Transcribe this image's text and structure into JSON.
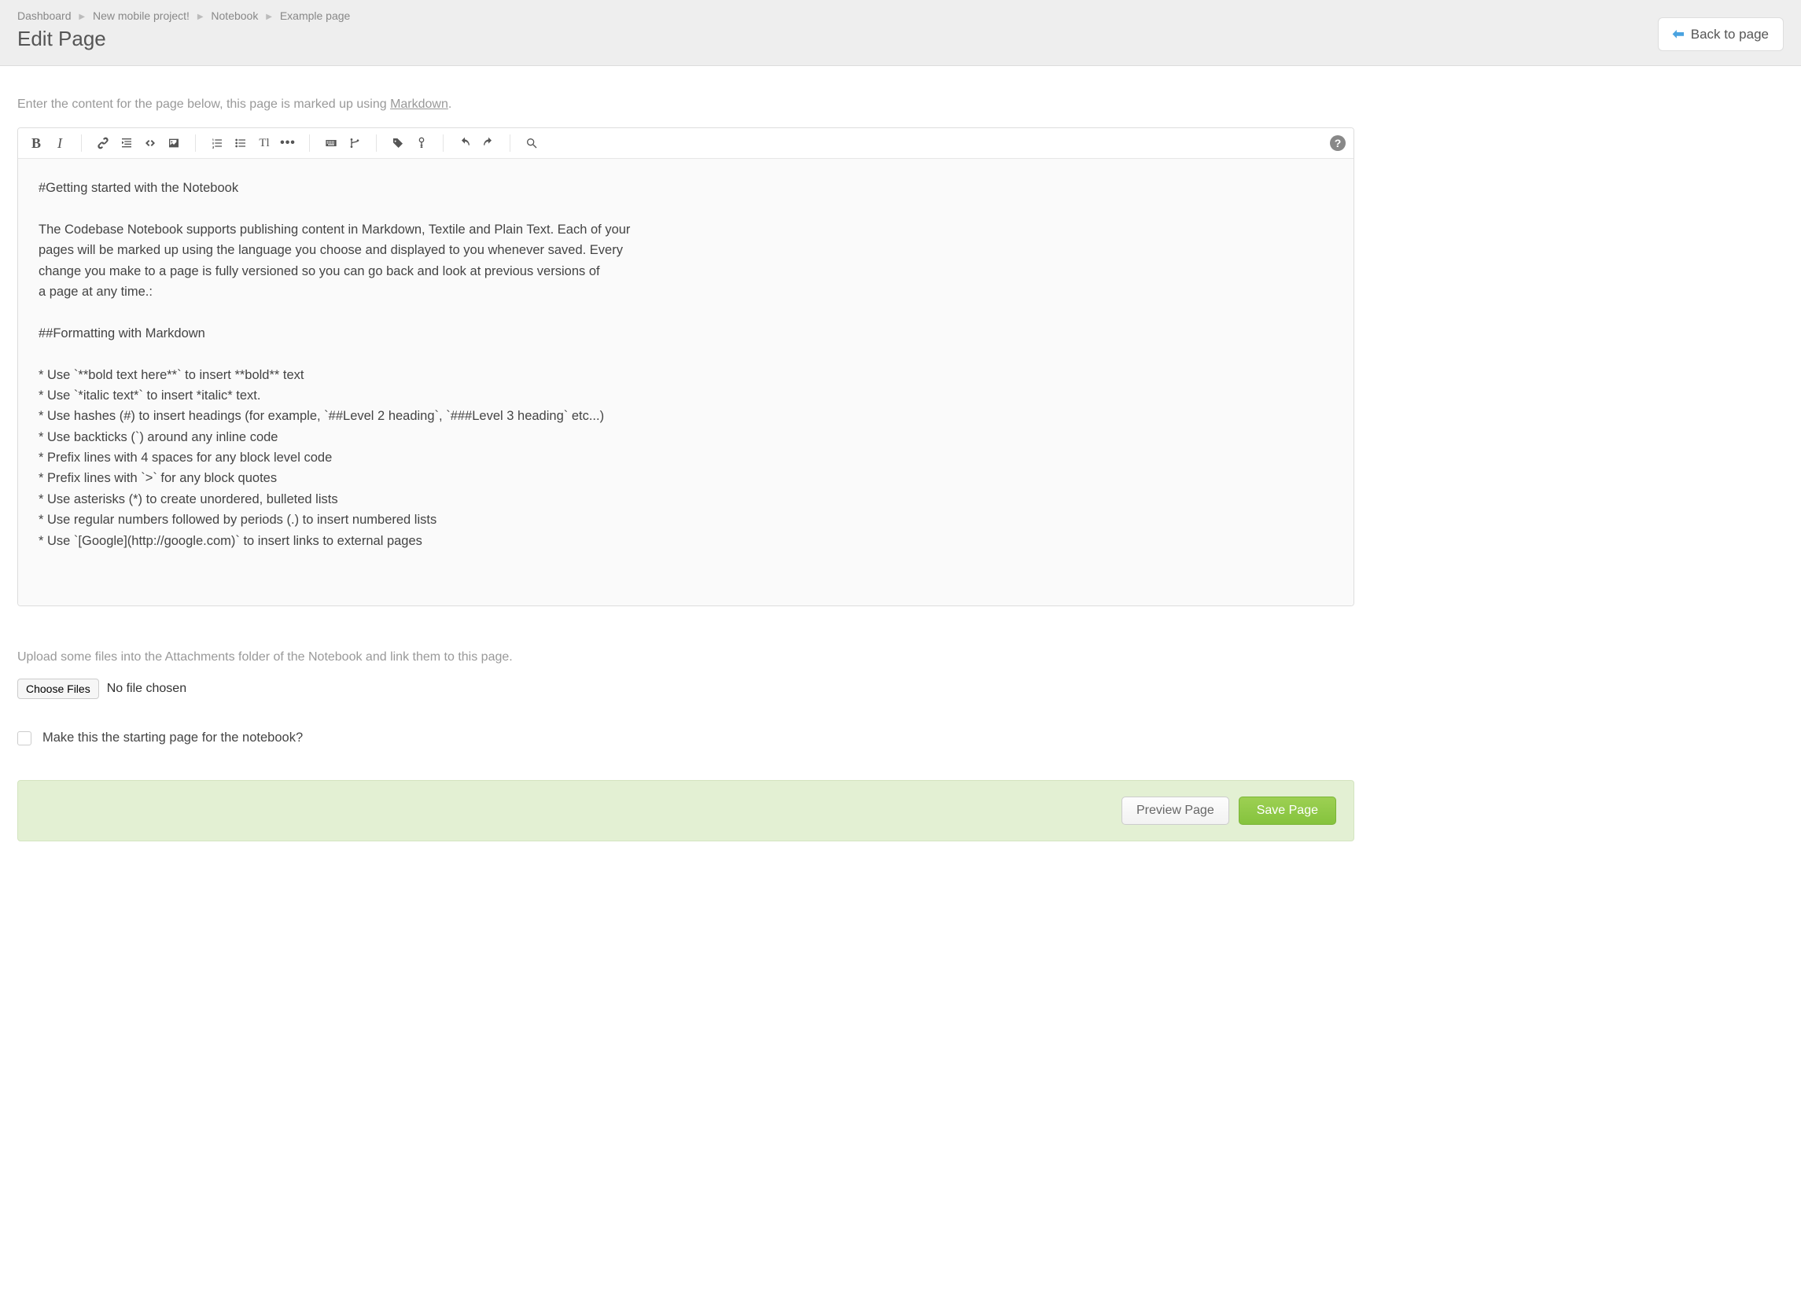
{
  "breadcrumb": {
    "items": [
      {
        "label": "Dashboard"
      },
      {
        "label": "New mobile project!"
      },
      {
        "label": "Notebook"
      },
      {
        "label": "Example page"
      }
    ]
  },
  "header": {
    "title": "Edit Page",
    "back_button": "Back to page"
  },
  "helper": {
    "prefix": "Enter the content for the page below, this page is marked up using ",
    "link": "Markdown",
    "suffix": "."
  },
  "editor": {
    "content": "#Getting started with the Notebook\n\nThe Codebase Notebook supports publishing content in Markdown, Textile and Plain Text. Each of your\npages will be marked up using the language you choose and displayed to you whenever saved. Every\nchange you make to a page is fully versioned so you can go back and look at previous versions of\na page at any time.:\n\n##Formatting with Markdown\n\n* Use `**bold text here**` to insert **bold** text\n* Use `*italic text*` to insert *italic* text.\n* Use hashes (#) to insert headings (for example, `##Level 2 heading`, `###Level 3 heading` etc...)\n* Use backticks (`) around any inline code\n* Prefix lines with 4 spaces for any block level code\n* Prefix lines with `>` for any block quotes\n* Use asterisks (*) to create unordered, bulleted lists\n* Use regular numbers followed by periods (.) to insert numbered lists\n* Use `[Google](http://google.com)` to insert links to external pages"
  },
  "upload": {
    "help": "Upload some files into the Attachments folder of the Notebook and link them to this page.",
    "choose_label": "Choose Files",
    "status": "No file chosen"
  },
  "checkbox": {
    "label": "Make this the starting page for the notebook?"
  },
  "footer": {
    "preview": "Preview Page",
    "save": "Save Page"
  }
}
